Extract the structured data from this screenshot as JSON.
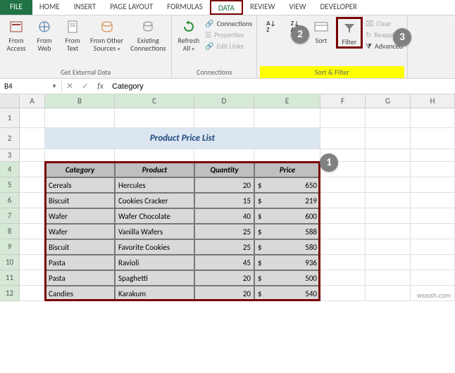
{
  "tabs": {
    "file": "FILE",
    "home": "HOME",
    "insert": "INSERT",
    "pageLayout": "PAGE LAYOUT",
    "formulas": "FORMULAS",
    "data": "DATA",
    "review": "REVIEW",
    "view": "VIEW",
    "developer": "DEVELOPER"
  },
  "ribbon": {
    "getExternal": {
      "label": "Get External Data",
      "fromAccess": "From\nAccess",
      "fromWeb": "From\nWeb",
      "fromText": "From\nText",
      "fromOther": "From Other\nSources",
      "existing": "Existing\nConnections"
    },
    "connections": {
      "label": "Connections",
      "refresh": "Refresh\nAll",
      "connections": "Connections",
      "properties": "Properties",
      "editLinks": "Edit Links"
    },
    "sortFilter": {
      "label": "Sort & Filter",
      "sort": "Sort",
      "filter": "Filter",
      "clear": "Clear",
      "reapply": "Reapply",
      "advanced": "Advanced"
    }
  },
  "formulaBar": {
    "nameBox": "B4",
    "formula": "Category"
  },
  "columns": [
    "A",
    "B",
    "C",
    "D",
    "E",
    "F",
    "G",
    "H"
  ],
  "rows": [
    "1",
    "2",
    "3",
    "4",
    "5",
    "6",
    "7",
    "8",
    "9",
    "10",
    "11",
    "12"
  ],
  "title": "Product Price List",
  "table": {
    "headers": {
      "category": "Category",
      "product": "Product",
      "quantity": "Quantity",
      "price": "Price"
    },
    "rows": [
      {
        "category": "Cereals",
        "product": "Hercules",
        "quantity": "20",
        "priceSym": "$",
        "price": "650"
      },
      {
        "category": "Biscuit",
        "product": "Cookies Cracker",
        "quantity": "15",
        "priceSym": "$",
        "price": "219"
      },
      {
        "category": "Wafer",
        "product": "Wafer Chocolate",
        "quantity": "40",
        "priceSym": "$",
        "price": "600"
      },
      {
        "category": "Wafer",
        "product": "Vanilla Wafers",
        "quantity": "25",
        "priceSym": "$",
        "price": "588"
      },
      {
        "category": "Biscuit",
        "product": "Favorite Cookies",
        "quantity": "25",
        "priceSym": "$",
        "price": "580"
      },
      {
        "category": "Pasta",
        "product": "Ravioli",
        "quantity": "45",
        "priceSym": "$",
        "price": "936"
      },
      {
        "category": "Pasta",
        "product": "Spaghetti",
        "quantity": "20",
        "priceSym": "$",
        "price": "500"
      },
      {
        "category": "Candies",
        "product": "Karakum",
        "quantity": "20",
        "priceSym": "$",
        "price": "540"
      }
    ]
  },
  "callouts": {
    "c1": "1",
    "c2": "2",
    "c3": "3"
  },
  "watermark": "wsxssh.com"
}
